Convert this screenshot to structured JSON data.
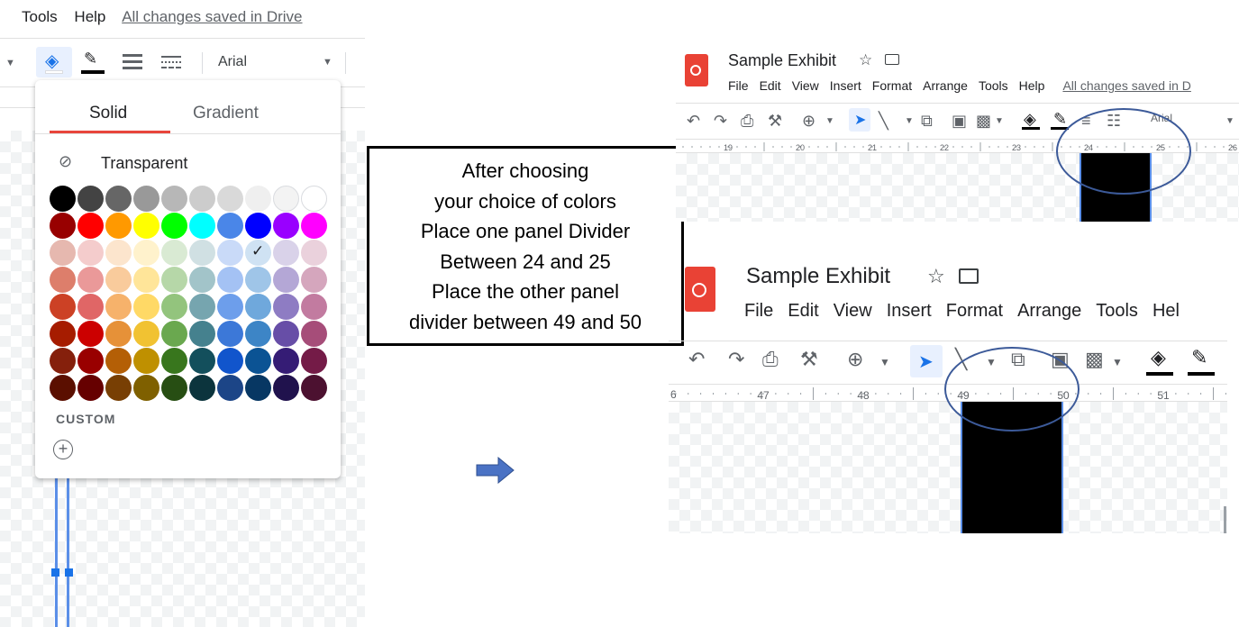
{
  "left_panel": {
    "menu_tools": "Tools",
    "menu_help": "Help",
    "saved_status": "All changes saved in Drive",
    "font_name": "Arial",
    "tab_solid": "Solid",
    "tab_gradient": "Gradient",
    "transparent_label": "Transparent",
    "custom_label": "CUSTOM",
    "palette_rows": [
      [
        "#000000",
        "#434343",
        "#666666",
        "#999999",
        "#b7b7b7",
        "#cccccc",
        "#d9d9d9",
        "#efefef",
        "#f3f3f3",
        "#ffffff"
      ],
      [
        "#980000",
        "#ff0000",
        "#ff9900",
        "#ffff00",
        "#00ff00",
        "#00ffff",
        "#4a86e8",
        "#0000ff",
        "#9900ff",
        "#ff00ff"
      ],
      [
        "#e6b8af",
        "#f4cccc",
        "#fce5cd",
        "#fff2cc",
        "#d9ead3",
        "#d0e0e3",
        "#c9daf8",
        "#cfe2f3",
        "#d9d2e9",
        "#ead1dc"
      ],
      [
        "#dd7e6b",
        "#ea9999",
        "#f9cb9c",
        "#ffe599",
        "#b6d7a8",
        "#a2c4c9",
        "#a4c2f4",
        "#9fc5e8",
        "#b4a7d6",
        "#d5a6bd"
      ],
      [
        "#cc4125",
        "#e06666",
        "#f6b26b",
        "#ffd966",
        "#93c47d",
        "#76a5af",
        "#6d9eeb",
        "#6fa8dc",
        "#8e7cc3",
        "#c27ba0"
      ],
      [
        "#a61c00",
        "#cc0000",
        "#e69138",
        "#f1c232",
        "#6aa84f",
        "#45818e",
        "#3c78d8",
        "#3d85c6",
        "#674ea7",
        "#a64d79"
      ],
      [
        "#85200c",
        "#990000",
        "#b45f06",
        "#bf9000",
        "#38761d",
        "#134f5c",
        "#1155cc",
        "#0b5394",
        "#351c75",
        "#741b47"
      ],
      [
        "#5b0f00",
        "#660000",
        "#783f04",
        "#7f6000",
        "#274e13",
        "#0c343d",
        "#1c4587",
        "#073763",
        "#20124d",
        "#4c1130"
      ]
    ],
    "selected_swatch": {
      "row": 2,
      "col": 7
    }
  },
  "instruction_box": {
    "lines": [
      "After choosing",
      "your choice of colors",
      "Place one panel Divider",
      "Between 24 and 25",
      "Place the other panel",
      "divider between 49 and 50"
    ]
  },
  "arrow": {
    "color": "#4a72c4"
  },
  "top_right": {
    "doc_title": "Sample Exhibit",
    "menu": [
      "File",
      "Edit",
      "View",
      "Insert",
      "Format",
      "Arrange",
      "Tools",
      "Help"
    ],
    "saved_status": "All changes saved in D",
    "font_name": "Arial",
    "ruler_labels": [
      "19",
      "20",
      "21",
      "22",
      "23",
      "24",
      "25",
      "26"
    ]
  },
  "bottom_right": {
    "doc_title": "Sample Exhibit",
    "menu": [
      "File",
      "Edit",
      "View",
      "Insert",
      "Format",
      "Arrange",
      "Tools",
      "Hel"
    ],
    "ruler_edge": "6",
    "ruler_labels": [
      "47",
      "48",
      "49",
      "50",
      "51"
    ]
  },
  "colors": {
    "accent_blue": "#1a73e8",
    "tab_underline": "#e8453c",
    "circle_annotation": "#3c5a99",
    "divider_fill": "#000000"
  }
}
